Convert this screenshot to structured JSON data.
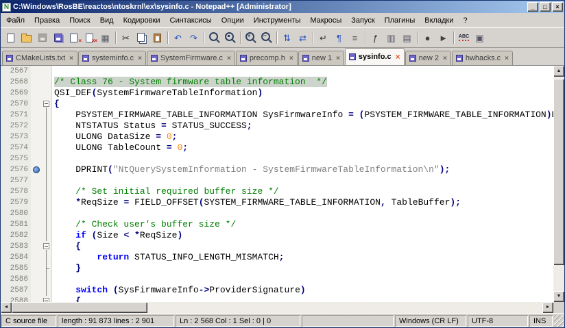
{
  "window": {
    "title": "C:\\Windows\\RosBE\\reactos\\ntoskrnl\\ex\\sysinfo.c - Notepad++ [Administrator]",
    "app_icon": "N",
    "controls": [
      {
        "name": "minimize",
        "glyph": "_"
      },
      {
        "name": "maximize",
        "glyph": "□"
      },
      {
        "name": "close",
        "glyph": "×"
      }
    ]
  },
  "menu": {
    "items": [
      {
        "name": "file",
        "label": "Файл"
      },
      {
        "name": "edit",
        "label": "Правка"
      },
      {
        "name": "search",
        "label": "Поиск"
      },
      {
        "name": "view",
        "label": "Вид"
      },
      {
        "name": "encodings",
        "label": "Кодировки"
      },
      {
        "name": "language",
        "label": "Синтаксисы"
      },
      {
        "name": "settings",
        "label": "Опции"
      },
      {
        "name": "tools",
        "label": "Инструменты"
      },
      {
        "name": "macro",
        "label": "Макросы"
      },
      {
        "name": "run",
        "label": "Запуск"
      },
      {
        "name": "plugins",
        "label": "Плагины"
      },
      {
        "name": "tabs",
        "label": "Вкладки"
      },
      {
        "name": "help",
        "label": "?"
      }
    ]
  },
  "toolbar": {
    "groups": [
      [
        {
          "name": "new-file",
          "type": "page"
        },
        {
          "name": "open-file",
          "type": "folder"
        },
        {
          "name": "save",
          "type": "disk",
          "disabled": true
        },
        {
          "name": "save-all",
          "type": "disk2"
        },
        {
          "name": "close-file",
          "type": "page",
          "overlay": "×"
        },
        {
          "name": "close-all",
          "type": "page",
          "overlay": "××"
        },
        {
          "name": "print",
          "glyph": "▦",
          "color": "#555a66"
        }
      ],
      [
        {
          "name": "cut",
          "glyph": "✂",
          "color": "#333333"
        },
        {
          "name": "copy",
          "type": "copy"
        },
        {
          "name": "paste",
          "type": "paste"
        }
      ],
      [
        {
          "name": "undo",
          "glyph": "↶",
          "color": "#1f4fbf"
        },
        {
          "name": "redo",
          "glyph": "↷",
          "color": "#1f4fbf"
        }
      ],
      [
        {
          "name": "find",
          "type": "find"
        },
        {
          "name": "replace",
          "type": "findr"
        }
      ],
      [
        {
          "name": "zoom-in",
          "type": "zoomin"
        },
        {
          "name": "zoom-out",
          "type": "zoomout"
        }
      ],
      [
        {
          "name": "sync-vertical",
          "glyph": "⇅",
          "color": "#1f4fbf"
        },
        {
          "name": "sync-horizontal",
          "glyph": "⇄",
          "color": "#1f4fbf"
        }
      ],
      [
        {
          "name": "word-wrap",
          "glyph": "↵",
          "color": "#333333"
        },
        {
          "name": "show-all-characters",
          "glyph": "¶",
          "color": "#2a52be"
        },
        {
          "name": "indent-guide",
          "glyph": "≡",
          "color": "#555555"
        }
      ],
      [
        {
          "name": "function-list",
          "glyph": "ƒ",
          "color": "#333333"
        },
        {
          "name": "document-map",
          "glyph": "▥",
          "color": "#555566"
        },
        {
          "name": "document-list",
          "glyph": "▤",
          "color": "#555566"
        }
      ],
      [
        {
          "name": "record-macro",
          "glyph": "●",
          "color": "#404040"
        },
        {
          "name": "play-macro",
          "glyph": "►",
          "color": "#404040"
        }
      ],
      [
        {
          "name": "spell-check",
          "type": "abc",
          "glyph": "ABC"
        },
        {
          "name": "document-monitor",
          "glyph": "▣",
          "color": "#555566"
        }
      ]
    ]
  },
  "tabs": [
    {
      "label": "CMakeLists.txt",
      "active": false
    },
    {
      "label": "systeminfo.c",
      "active": false
    },
    {
      "label": "SystemFirmware.c",
      "active": false
    },
    {
      "label": "precomp.h",
      "active": false
    },
    {
      "label": "new 1",
      "active": false
    },
    {
      "label": "sysinfo.c",
      "active": true
    },
    {
      "label": "new 2",
      "active": false
    },
    {
      "label": "hwhacks.c",
      "active": false
    }
  ],
  "editor": {
    "lines": [
      {
        "num": "2567",
        "fold": "",
        "bm": false,
        "seg": []
      },
      {
        "num": "2568",
        "fold": "",
        "bm": false,
        "seg": [
          {
            "t": "/* Class 76 - System firmware table information  */",
            "c": "comment",
            "hl": true
          }
        ]
      },
      {
        "num": "2569",
        "fold": "",
        "bm": false,
        "seg": [
          {
            "t": "QSI_DEF",
            "c": "plain"
          },
          {
            "t": "(",
            "c": "op"
          },
          {
            "t": "SystemFirmwareTableInformation",
            "c": "plain"
          },
          {
            "t": ")",
            "c": "op"
          }
        ]
      },
      {
        "num": "2570",
        "fold": "box",
        "bm": false,
        "seg": [
          {
            "t": "{",
            "c": "op"
          }
        ]
      },
      {
        "num": "2571",
        "fold": "line",
        "bm": false,
        "seg": [
          {
            "t": "    PSYSTEM_FIRMWARE_TABLE_INFORMATION SysFirmwareInfo ",
            "c": "plain"
          },
          {
            "t": "= (",
            "c": "op"
          },
          {
            "t": "PSYSTEM_FIRMWARE_TABLE_INFORMATION",
            "c": "plain"
          },
          {
            "t": ")",
            "c": "op"
          },
          {
            "t": "Buffer",
            "c": "plain"
          },
          {
            "t": ";",
            "c": "op"
          }
        ]
      },
      {
        "num": "2572",
        "fold": "line",
        "bm": false,
        "seg": [
          {
            "t": "    NTSTATUS Status ",
            "c": "plain"
          },
          {
            "t": "= ",
            "c": "op"
          },
          {
            "t": "STATUS_SUCCESS",
            "c": "plain"
          },
          {
            "t": ";",
            "c": "op"
          }
        ]
      },
      {
        "num": "2573",
        "fold": "line",
        "bm": false,
        "seg": [
          {
            "t": "    ULONG DataSize ",
            "c": "plain"
          },
          {
            "t": "= ",
            "c": "op"
          },
          {
            "t": "0",
            "c": "number"
          },
          {
            "t": ";",
            "c": "op"
          }
        ]
      },
      {
        "num": "2574",
        "fold": "line",
        "bm": false,
        "seg": [
          {
            "t": "    ULONG TableCount ",
            "c": "plain"
          },
          {
            "t": "= ",
            "c": "op"
          },
          {
            "t": "0",
            "c": "number"
          },
          {
            "t": ";",
            "c": "op"
          }
        ]
      },
      {
        "num": "2575",
        "fold": "line",
        "bm": false,
        "seg": []
      },
      {
        "num": "2576",
        "fold": "line",
        "bm": true,
        "seg": [
          {
            "t": "    DPRINT",
            "c": "plain"
          },
          {
            "t": "(",
            "c": "op"
          },
          {
            "t": "\"NtQuerySystemInformation - SystemFirmwareTableInformation\\n\"",
            "c": "string"
          },
          {
            "t": ");",
            "c": "op"
          }
        ]
      },
      {
        "num": "2577",
        "fold": "line",
        "bm": false,
        "seg": []
      },
      {
        "num": "2578",
        "fold": "line",
        "bm": false,
        "seg": [
          {
            "t": "    ",
            "c": "plain"
          },
          {
            "t": "/* Set initial required buffer size */",
            "c": "comment"
          }
        ]
      },
      {
        "num": "2579",
        "fold": "line",
        "bm": false,
        "seg": [
          {
            "t": "    ",
            "c": "plain"
          },
          {
            "t": "*",
            "c": "op"
          },
          {
            "t": "ReqSize ",
            "c": "plain"
          },
          {
            "t": "= ",
            "c": "op"
          },
          {
            "t": "FIELD_OFFSET",
            "c": "plain"
          },
          {
            "t": "(",
            "c": "op"
          },
          {
            "t": "SYSTEM_FIRMWARE_TABLE_INFORMATION",
            "c": "plain"
          },
          {
            "t": ",",
            "c": "op"
          },
          {
            "t": " TableBuffer",
            "c": "plain"
          },
          {
            "t": ");",
            "c": "op"
          }
        ]
      },
      {
        "num": "2580",
        "fold": "line",
        "bm": false,
        "seg": []
      },
      {
        "num": "2581",
        "fold": "line",
        "bm": false,
        "seg": [
          {
            "t": "    ",
            "c": "plain"
          },
          {
            "t": "/* Check user's buffer size */",
            "c": "comment"
          }
        ]
      },
      {
        "num": "2582",
        "fold": "line",
        "bm": false,
        "seg": [
          {
            "t": "    ",
            "c": "plain"
          },
          {
            "t": "if",
            "c": "keyword"
          },
          {
            "t": " (",
            "c": "op"
          },
          {
            "t": "Size ",
            "c": "plain"
          },
          {
            "t": "< *",
            "c": "op"
          },
          {
            "t": "ReqSize",
            "c": "plain"
          },
          {
            "t": ")",
            "c": "op"
          }
        ]
      },
      {
        "num": "2583",
        "fold": "box",
        "bm": false,
        "seg": [
          {
            "t": "    ",
            "c": "plain"
          },
          {
            "t": "{",
            "c": "op"
          }
        ]
      },
      {
        "num": "2584",
        "fold": "line",
        "bm": false,
        "seg": [
          {
            "t": "        ",
            "c": "plain"
          },
          {
            "t": "return",
            "c": "keyword"
          },
          {
            "t": " STATUS_INFO_LENGTH_MISMATCH",
            "c": "plain"
          },
          {
            "t": ";",
            "c": "op"
          }
        ]
      },
      {
        "num": "2585",
        "fold": "end",
        "bm": false,
        "seg": [
          {
            "t": "    ",
            "c": "plain"
          },
          {
            "t": "}",
            "c": "op"
          }
        ]
      },
      {
        "num": "2586",
        "fold": "line",
        "bm": false,
        "seg": []
      },
      {
        "num": "2587",
        "fold": "line",
        "bm": false,
        "seg": [
          {
            "t": "    ",
            "c": "plain"
          },
          {
            "t": "switch",
            "c": "keyword"
          },
          {
            "t": " (",
            "c": "op"
          },
          {
            "t": "SysFirmwareInfo",
            "c": "plain"
          },
          {
            "t": "->",
            "c": "op"
          },
          {
            "t": "ProviderSignature",
            "c": "plain"
          },
          {
            "t": ")",
            "c": "op"
          }
        ]
      },
      {
        "num": "2588",
        "fold": "box",
        "bm": false,
        "seg": [
          {
            "t": "    ",
            "c": "plain"
          },
          {
            "t": "{",
            "c": "op"
          }
        ]
      }
    ]
  },
  "status": {
    "panels": [
      {
        "name": "doc-type",
        "text": "C source file",
        "width": 80
      },
      {
        "name": "length-lines",
        "text": "length : 91 873    lines : 2 901",
        "width": 170
      },
      {
        "name": "cursor-position",
        "text": "Ln : 2 568    Col : 1    Sel : 0 | 0",
        "width": 182
      },
      {
        "name": "spacer",
        "text": "",
        "flex": true
      },
      {
        "name": "eol-format",
        "text": "Windows (CR LF)",
        "width": 104
      },
      {
        "name": "encoding",
        "text": "UTF-8",
        "width": 88
      },
      {
        "name": "insert-mode",
        "text": "INS",
        "width": 34
      }
    ]
  },
  "colors": {
    "titlebar_left": "#0a246a",
    "titlebar_right": "#a6caf0",
    "chrome": "#d6d3ce",
    "comment": "#008000",
    "keyword": "#0000ff",
    "string": "#808080",
    "number": "#ff8000",
    "op": "#000080",
    "selection": "#ccd4cb",
    "bookmark": "#2f66b5"
  }
}
